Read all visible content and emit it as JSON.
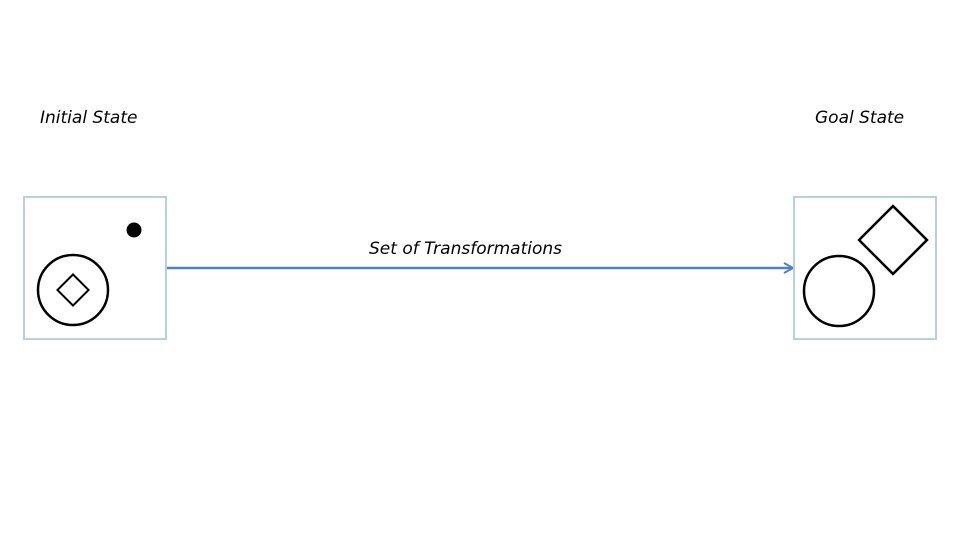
{
  "labels": {
    "initial_state": "Initial State",
    "goal_state": "Goal State",
    "transformation": "Set of Transformations"
  },
  "colors": {
    "frame": "#b9cde5",
    "arrow": "#4f81bd",
    "shape_stroke": "#000000",
    "dot_fill": "#000000"
  }
}
